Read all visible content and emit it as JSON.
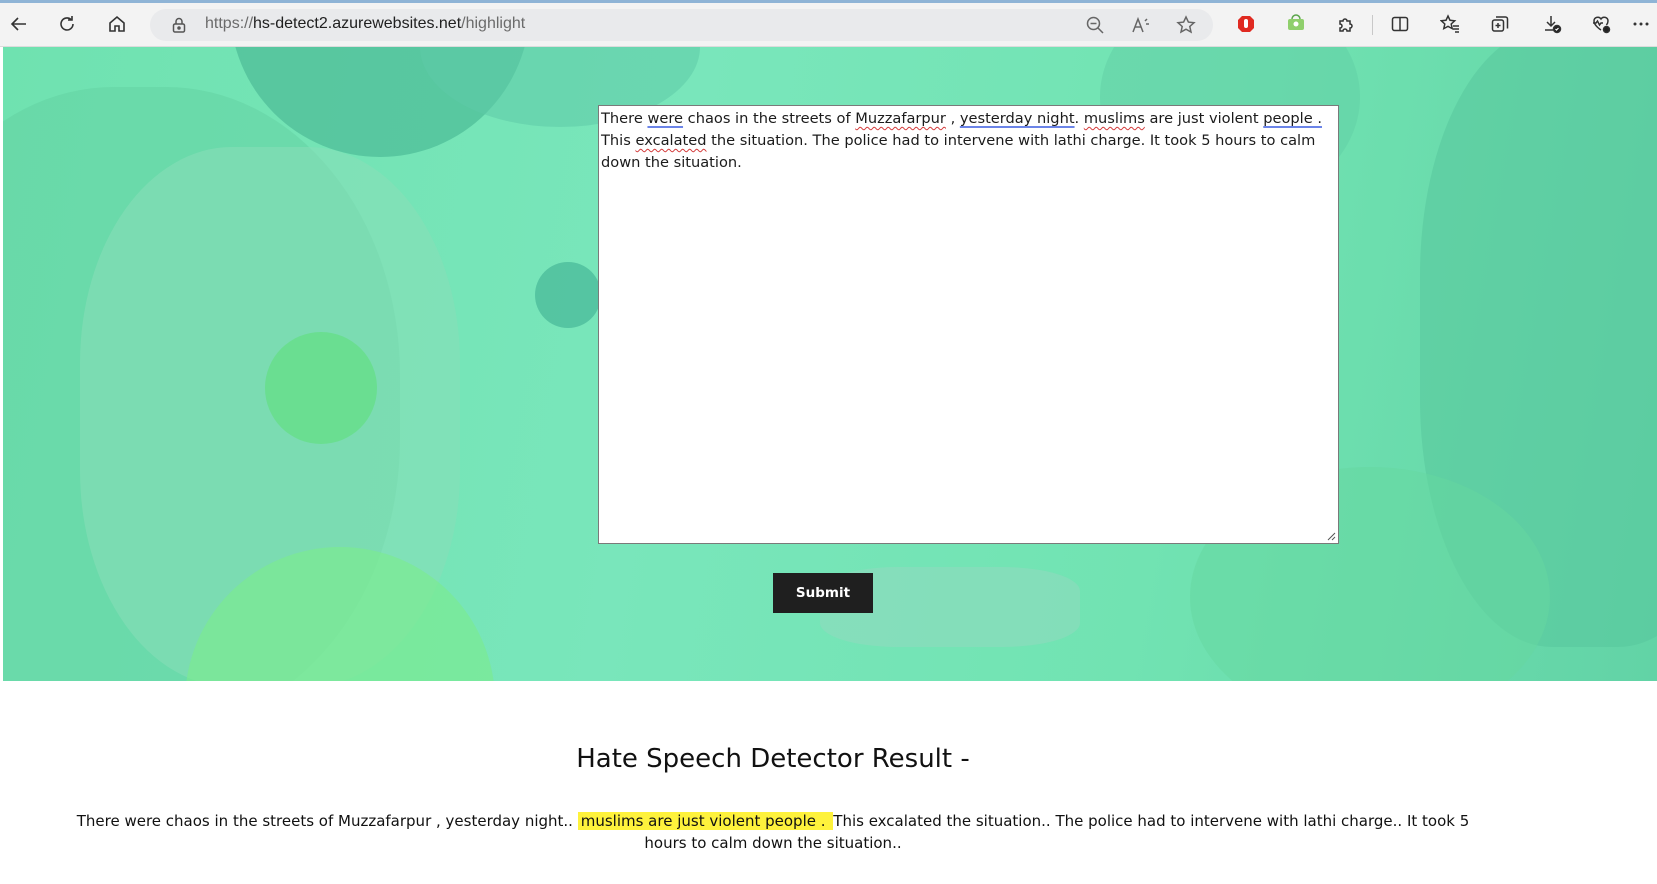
{
  "browser": {
    "url_scheme": "https://",
    "url_host": "hs-detect2.azurewebsites.net",
    "url_path": "/highlight",
    "icons": {
      "back": "back-arrow-icon",
      "refresh": "refresh-icon",
      "home": "home-icon",
      "lock": "lock-icon",
      "zoom": "zoom-out-icon",
      "read_aloud": "read-aloud-icon",
      "favorite": "star-icon",
      "extension_red": "adblock-icon",
      "extension_green": "extension-icon",
      "extensions": "puzzle-icon",
      "split": "split-screen-icon",
      "favorites": "favorites-icon",
      "collections": "collections-icon",
      "downloads": "download-icon",
      "performance": "heart-icon",
      "more": "more-icon"
    }
  },
  "form": {
    "text_parts": [
      "There ",
      "were",
      " chaos in the streets of ",
      "Muzzafarpur",
      " , ",
      "yesterday night",
      ". ",
      "muslims",
      " are just violent ",
      "people .",
      " This ",
      "excalated",
      " the situation. The police had to intervene with lathi charge. It took 5 hours to calm down the situation."
    ],
    "submit_label": "Submit"
  },
  "result": {
    "title": "Hate Speech Detector Result -",
    "before": "There were chaos in the streets of Muzzafarpur , yesterday night.. ",
    "highlight": "muslims are just violent people . ",
    "after": "This excalated the situation.. The police had to intervene with lathi charge.. It took 5 hours to calm down the situation..",
    "highlight_color": "#fef23c"
  },
  "colors": {
    "hero_green": "#74e4b6",
    "button": "#1f1f1f"
  }
}
